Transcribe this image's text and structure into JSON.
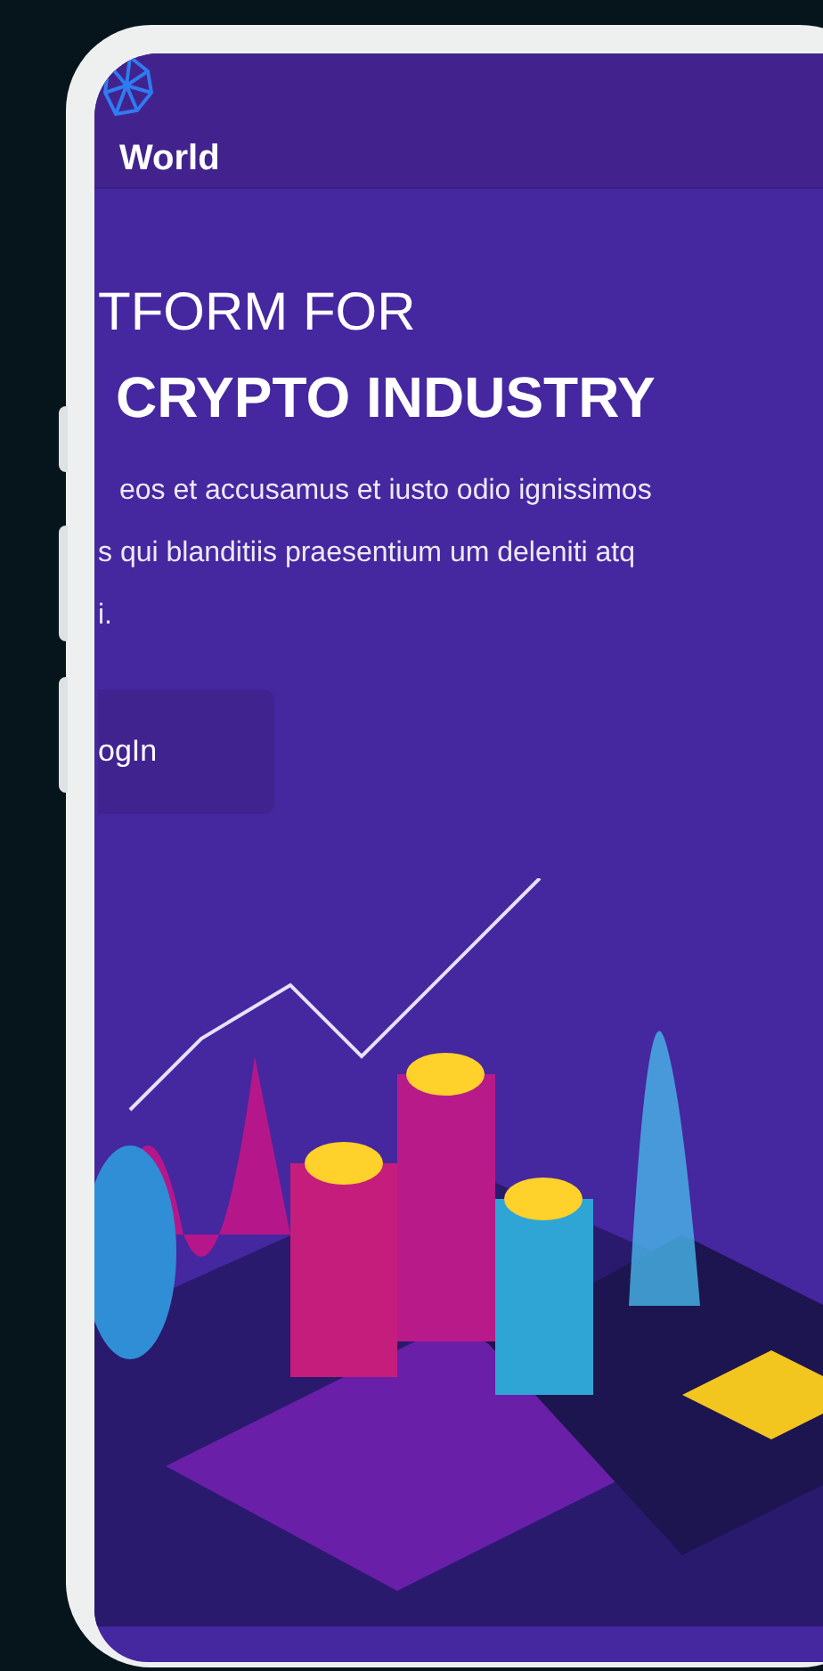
{
  "header": {
    "brand": "World"
  },
  "hero": {
    "heading_line_1": "TFORM FOR",
    "heading_line_2": "CRYPTO INDUSTRY",
    "description_lines": [
      "eos et accusamus et iusto odio ignissimos",
      "s qui blanditiis praesentium um deleniti atq",
      "i."
    ],
    "login_button": "ogIn"
  }
}
